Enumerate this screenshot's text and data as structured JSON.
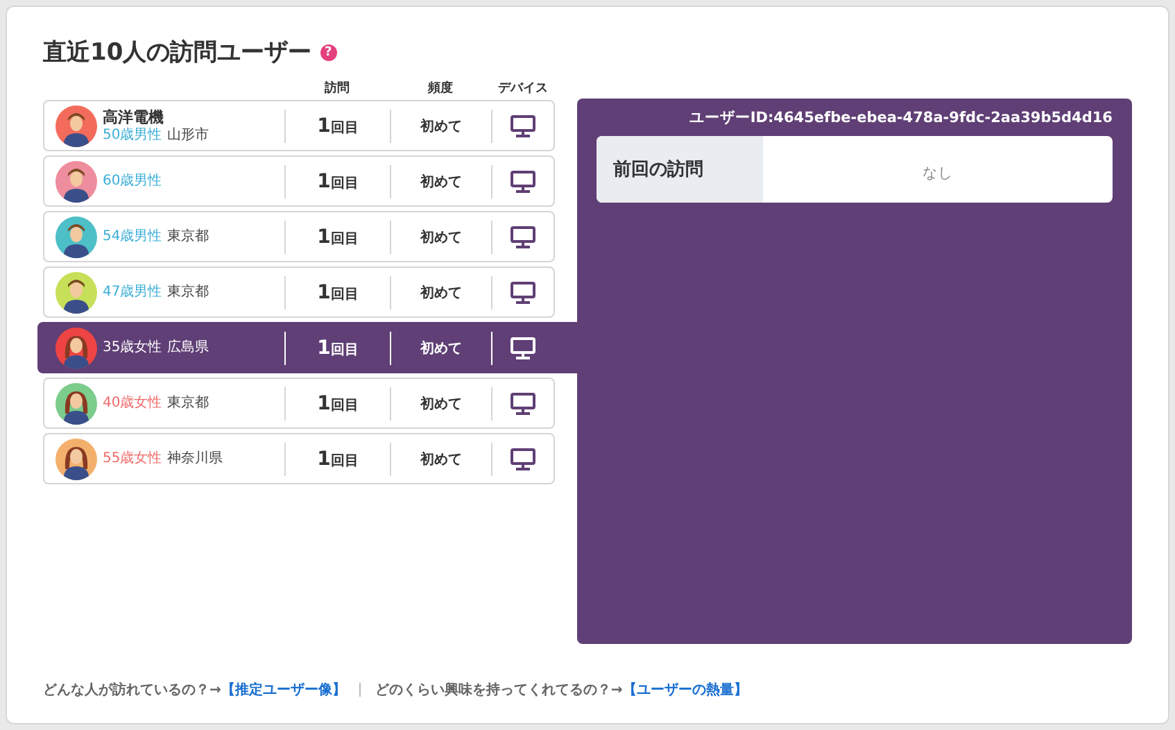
{
  "title": "直近10人の訪問ユーザー",
  "help": "?",
  "columns": [
    "訪問",
    "頻度",
    "デバイス"
  ],
  "visitors": [
    {
      "company": "高洋電機",
      "demographic": "50歳男性",
      "location": "山形市",
      "kind": "male",
      "color": "#f26b5b",
      "visits": "**1**回目",
      "frequency": "初めて",
      "selected": false
    },
    {
      "demographic": "60歳男性",
      "kind": "male",
      "color": "#ee8d9d",
      "visits": "**1**回目",
      "frequency": "初めて",
      "selected": false
    },
    {
      "demographic": "54歳男性",
      "location": "東京都",
      "kind": "male",
      "color": "#4dbfc6",
      "visits": "**1**回目",
      "frequency": "初めて",
      "selected": false
    },
    {
      "demographic": "47歳男性",
      "location": "東京都",
      "kind": "male",
      "color": "#c6e05a",
      "visits": "**1**回目",
      "frequency": "初めて",
      "selected": false
    },
    {
      "demographic": "35歳女性",
      "location": "広島県",
      "kind": "female",
      "color": "#ee4444",
      "visits": "**1**回目",
      "frequency": "初めて",
      "selected": true
    },
    {
      "demographic": "40歳女性",
      "location": "東京都",
      "kind": "female",
      "color": "#7ccc8c",
      "visits": "**1**回目",
      "frequency": "初めて",
      "selected": false
    },
    {
      "demographic": "55歳女性",
      "location": "神奈川県",
      "kind": "female",
      "color": "#f3b06c",
      "visits": "**1**回目",
      "frequency": "初めて",
      "selected": false
    }
  ],
  "detail": {
    "user_id": "ユーザーID:4645efbe-ebea-478a-9fdc-2aa39b5d4d16",
    "label": "前回の訪問",
    "value": "なし"
  },
  "footer": [
    {
      "text": "どんな人が訪れているの？→",
      "link": "【推定ユーザー像】"
    },
    {
      "text": "どのくらい興味を持ってくれてるの？→",
      "link": "【ユーザーの熱量】"
    }
  ]
}
